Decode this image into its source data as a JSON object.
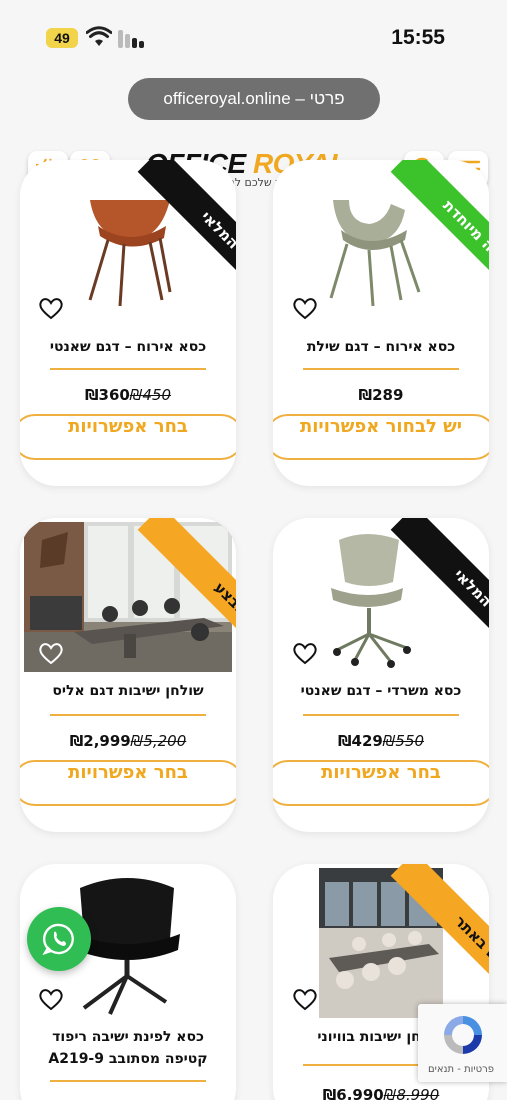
{
  "status_bar": {
    "battery": "49",
    "time": "15:55"
  },
  "browser": {
    "url_text": "officeroyal.online – פרטי"
  },
  "header": {
    "logo_office": "OFFICE ",
    "logo_royal": "ROYAL",
    "tagline": "הכתובת שלכם למשרד מושלם"
  },
  "currency": "₪",
  "products": [
    {
      "title": "כסא אירוח – דגם שאנטי",
      "price": "360",
      "old_price": "450",
      "button": "בחר אפשרויות",
      "ribbon": "אזל המלאי"
    },
    {
      "title": "כסא אירוח – דגם שילת",
      "price": "289",
      "old_price": "",
      "button": "יש לבחור אפשרויות",
      "ribbon": "בהזמנה מיוחדת"
    },
    {
      "title": "שולחן ישיבות דגם אליס",
      "price": "2,999",
      "old_price": "5,200",
      "button": "בחר אפשרויות",
      "ribbon": "מבצע"
    },
    {
      "title": "כסא משרדי – דגם שאנטי",
      "price": "429",
      "old_price": "550",
      "button": "בחר אפשרויות",
      "ribbon": "אזל המלאי"
    },
    {
      "title": "כסא לפינת ישיבה ריפוד קטיפה מסתובב A219-9",
      "price": "",
      "old_price": "",
      "button": "",
      "ribbon": ""
    },
    {
      "title": "שולחן ישיבות בוויוני",
      "price": "6,990",
      "old_price": "8,990",
      "button": "",
      "ribbon": "חדש באתר"
    }
  ],
  "recaptcha": {
    "label": "פרטיות - תנאים"
  },
  "icons": [
    "battery-icon",
    "wifi-icon",
    "signal-icon",
    "cart-icon",
    "wishlist-icon",
    "search-icon",
    "menu-icon",
    "heart-icon",
    "whatsapp-icon",
    "recaptcha-icon"
  ],
  "colors": {
    "accent": "#f0a820",
    "green_ribbon": "#3cc22a",
    "whatsapp": "#2fbd54"
  }
}
